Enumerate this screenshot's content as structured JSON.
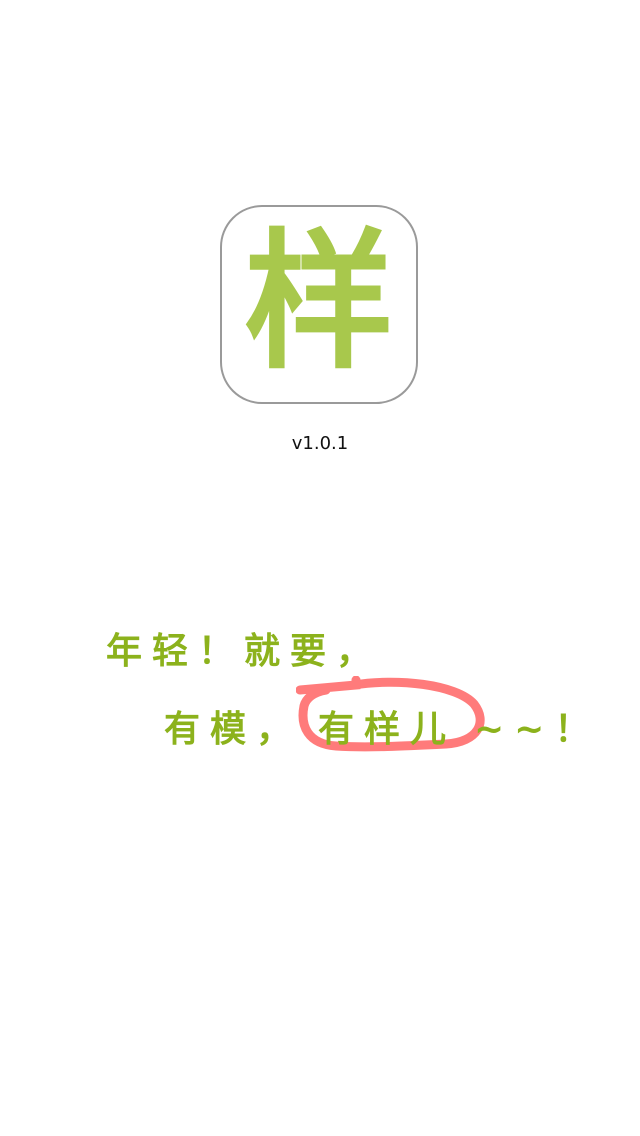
{
  "logo": {
    "character": "样",
    "color": "#a8c84c"
  },
  "version": "v1.0.1",
  "slogan": {
    "line1": "年轻！就要，",
    "line2_prefix": "有模，",
    "line2_highlight": "有样儿",
    "line2_suffix": "~~！",
    "text_color": "#8cb21c",
    "circle_color": "#ff7b7b"
  }
}
